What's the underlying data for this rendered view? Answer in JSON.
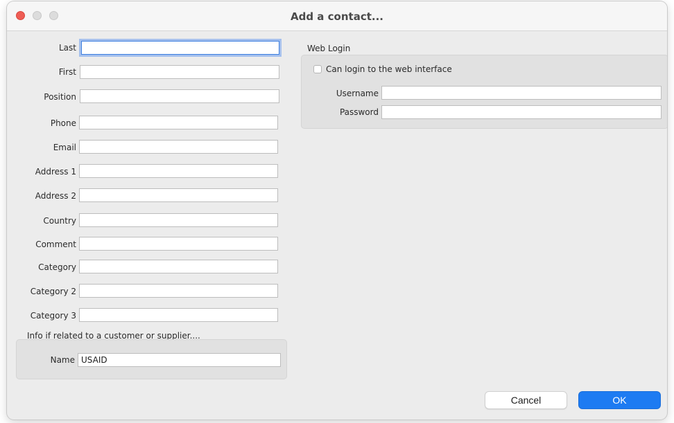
{
  "window": {
    "title": "Add a contact..."
  },
  "contact_form": {
    "fields": [
      {
        "label": "Last",
        "value": ""
      },
      {
        "label": "First",
        "value": ""
      },
      {
        "label": "Position",
        "value": ""
      },
      {
        "label": "Phone",
        "value": ""
      },
      {
        "label": "Email",
        "value": ""
      },
      {
        "label": "Address 1",
        "value": ""
      },
      {
        "label": "Address 2",
        "value": ""
      },
      {
        "label": "Country",
        "value": ""
      },
      {
        "label": "Comment",
        "value": ""
      },
      {
        "label": "Category",
        "value": ""
      },
      {
        "label": "Category 2",
        "value": ""
      },
      {
        "label": "Category 3",
        "value": ""
      }
    ]
  },
  "related": {
    "section_title": "Info if related to a customer or supplier....",
    "name_label": "Name",
    "name_value": "USAID"
  },
  "web_login": {
    "section_title": "Web Login",
    "checkbox_label": "Can login to the web interface",
    "checkbox_checked": false,
    "username_label": "Username",
    "username_value": "",
    "password_label": "Password",
    "password_value": ""
  },
  "buttons": {
    "cancel_label": "Cancel",
    "ok_label": "OK"
  },
  "colors": {
    "focus_ring": "#3d7fe0",
    "primary_button": "#1d7bf2",
    "close_button": "#ee5d55"
  }
}
